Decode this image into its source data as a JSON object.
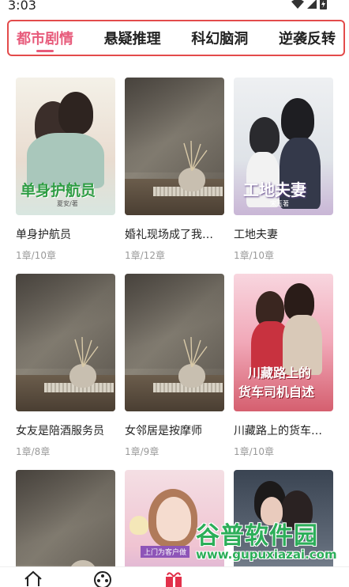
{
  "status": {
    "time": "3:03"
  },
  "tabs": [
    {
      "label": "都市剧情",
      "active": true
    },
    {
      "label": "悬疑推理",
      "active": false
    },
    {
      "label": "科幻脑洞",
      "active": false
    },
    {
      "label": "逆袭反转",
      "active": false
    }
  ],
  "books": [
    {
      "title": "单身护航员",
      "chapters": "1章/10章",
      "cover": "romance1",
      "cover_text": "单身护航员",
      "cover_author": "夏安/著"
    },
    {
      "title": "婚礼现场成了我…",
      "chapters": "1章/12章",
      "cover": "still"
    },
    {
      "title": "工地夫妻",
      "chapters": "1章/10章",
      "cover": "romance2",
      "cover_text": "工地夫妻",
      "cover_author": "宋玉著"
    },
    {
      "title": "女友是陪酒服务员",
      "chapters": "1章/8章",
      "cover": "still"
    },
    {
      "title": "女邻居是按摩师",
      "chapters": "1章/9章",
      "cover": "still"
    },
    {
      "title": "川藏路上的货车…",
      "chapters": "1章/10章",
      "cover": "romance3",
      "cover_text_line1": "川藏路上的",
      "cover_text_line2": "货车司机自述"
    },
    {
      "title": "",
      "chapters": "",
      "cover": "still"
    },
    {
      "title": "",
      "chapters": "",
      "cover": "romance4",
      "cover_text": "上门为客户做"
    },
    {
      "title": "",
      "chapters": "",
      "cover": "romance5"
    }
  ],
  "watermark": {
    "main": "谷普软件园",
    "url": "www.gupuxiazai.com"
  },
  "colors": {
    "accent": "#e75b7b",
    "highlight_border": "#e34b4b",
    "watermark": "#2cae59"
  }
}
